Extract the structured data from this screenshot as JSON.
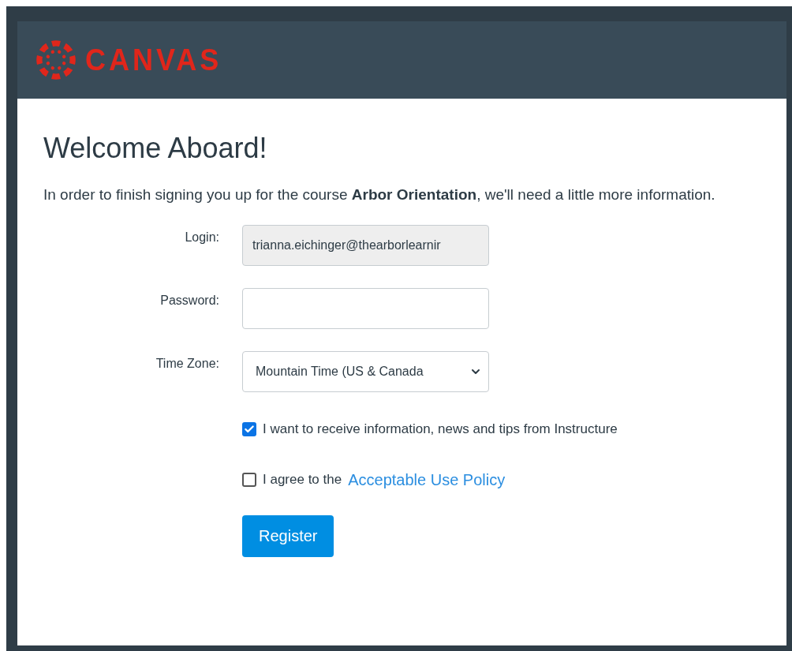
{
  "header": {
    "logo_text": "CANVAS"
  },
  "title": "Welcome Aboard!",
  "intro": "In order to finish signing you up for the course **Arbor Orientation**, we'll need a little more information.",
  "fields": [
    {
      "kind": "readonly",
      "label": "Login:",
      "value": "trianna.eichinger@thearborlearnir"
    },
    {
      "kind": "password",
      "label": "Password:"
    },
    {
      "kind": "select",
      "label": "Time Zone:",
      "value": "Mountain Time (US & Canada"
    }
  ],
  "checkboxes": [
    {
      "label": "I want to receive information, news and tips from Instructure",
      "checked": true
    },
    {
      "label": "I agree to the",
      "link": "Acceptable Use Policy",
      "checked": false
    }
  ],
  "submit": "Register"
}
